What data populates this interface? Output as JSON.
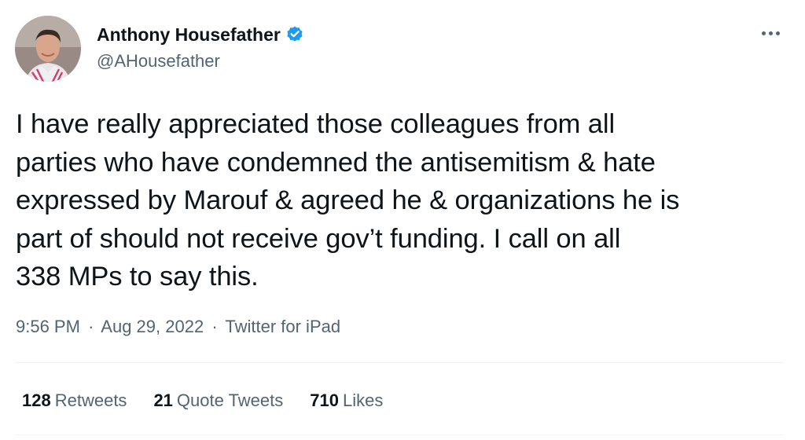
{
  "author": {
    "name": "Anthony Housefather",
    "handle": "@AHousefather",
    "verified": true
  },
  "tweet": {
    "text": "I have really appreciated those colleagues from all\nparties who have condemned the antisemitism & hate\nexpressed by Marouf & agreed he & organizations he is\npart of should not receive gov’t funding. I call on all\n338 MPs to say this."
  },
  "meta": {
    "time": "9:56 PM",
    "separator": "·",
    "date": "Aug 29, 2022",
    "source": "Twitter for iPad"
  },
  "stats": [
    {
      "count": "128",
      "label": "Retweets"
    },
    {
      "count": "21",
      "label": "Quote Tweets"
    },
    {
      "count": "710",
      "label": "Likes"
    }
  ],
  "icons": {
    "verified": "verified-badge-icon",
    "more": "more-options-icon"
  },
  "colors": {
    "text": "#0f1419",
    "secondary": "#536471",
    "verified": "#1d9bf0",
    "divider": "#eff3f4"
  }
}
